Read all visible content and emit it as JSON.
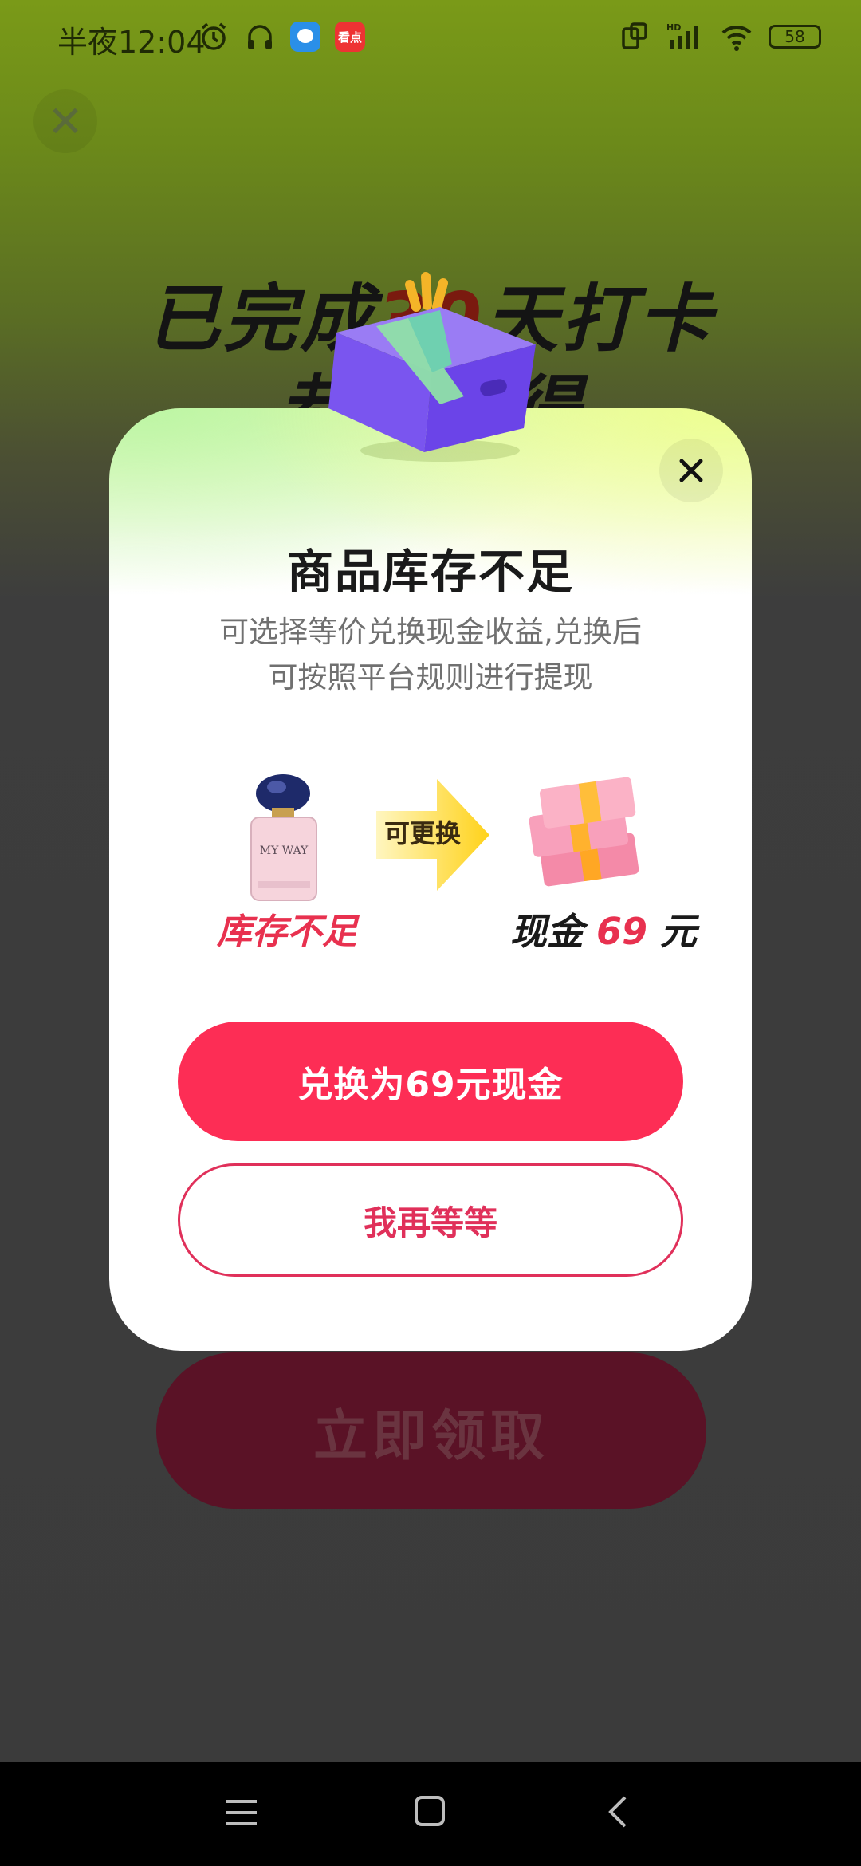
{
  "status_bar": {
    "time": "半夜12:04",
    "red_app_badge": "看点",
    "battery": "58",
    "network": "HD"
  },
  "background": {
    "title_line1_prefix": "已完成",
    "title_line1_number": "30",
    "title_line1_suffix": "天打卡",
    "title_line2": "恭喜获得",
    "claim_button": "立即领取"
  },
  "modal": {
    "title": "商品库存不足",
    "desc_line1": "可选择等价兑换现金收益,兑换后",
    "desc_line2": "可按照平台规则进行提现",
    "product_text": "MY WAY",
    "stock_label": "库存不足",
    "arrow_label": "可更换",
    "cash_prefix": "现金",
    "cash_amount": "69",
    "cash_unit": "元",
    "exchange_button": "兑换为69元现金",
    "wait_button": "我再等等"
  },
  "colors": {
    "accent": "#fd2d55",
    "accent_text": "#e8314f",
    "navbar": "#000000"
  },
  "icons": {
    "bg_close": "close-icon",
    "modal_close": "close-icon",
    "nav_menu": "menu-icon",
    "nav_home": "home-icon",
    "nav_back": "back-icon"
  }
}
